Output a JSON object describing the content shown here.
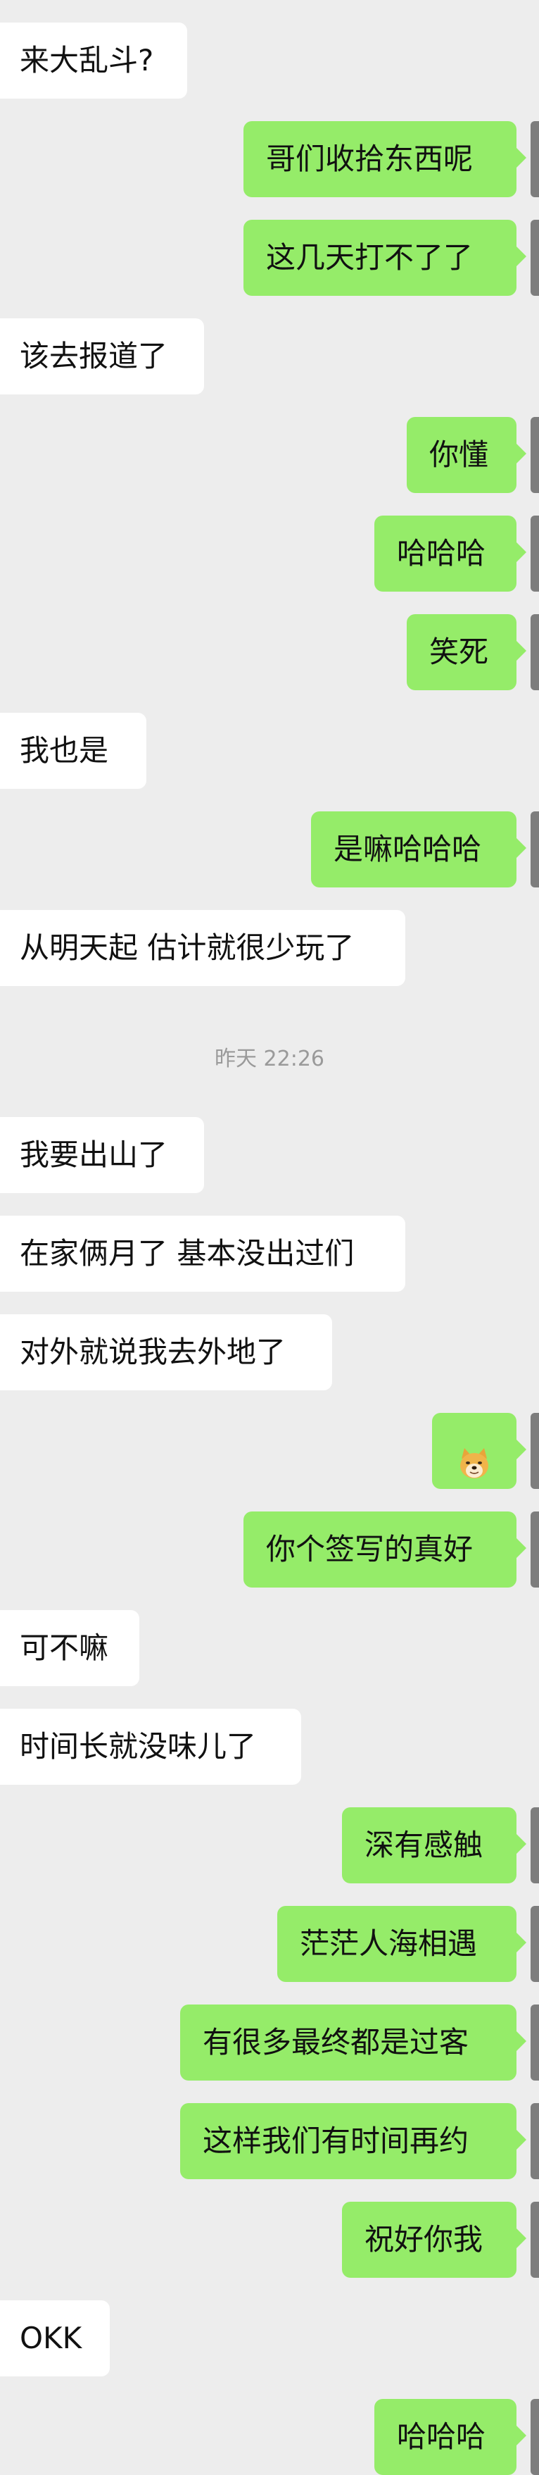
{
  "messages": [
    {
      "side": "left",
      "text": "来大乱斗?"
    },
    {
      "side": "right",
      "text": "哥们收拾东西呢"
    },
    {
      "side": "right",
      "text": "这几天打不了了"
    },
    {
      "side": "left",
      "text": "该去报道了"
    },
    {
      "side": "right",
      "text": "你懂"
    },
    {
      "side": "right",
      "text": "哈哈哈"
    },
    {
      "side": "right",
      "text": "笑死"
    },
    {
      "side": "left",
      "text": "我也是"
    },
    {
      "side": "right",
      "text": "是嘛哈哈哈"
    },
    {
      "side": "left",
      "text": "从明天起 估计就很少玩了"
    },
    {
      "side": "left",
      "text": "我要出山了"
    },
    {
      "side": "left",
      "text": "在家俩月了 基本没出过们"
    },
    {
      "side": "left",
      "text": "对外就说我去外地了"
    },
    {
      "side": "right",
      "text": "",
      "icon": "doge-emoji-icon"
    },
    {
      "side": "right",
      "text": "你个签写的真好"
    },
    {
      "side": "left",
      "text": "可不嘛"
    },
    {
      "side": "left",
      "text": "时间长就没味儿了"
    },
    {
      "side": "right",
      "text": "深有感触"
    },
    {
      "side": "right",
      "text": "茫茫人海相遇"
    },
    {
      "side": "right",
      "text": "有很多最终都是过客"
    },
    {
      "side": "right",
      "text": "这样我们有时间再约"
    },
    {
      "side": "right",
      "text": "祝好你我"
    },
    {
      "side": "left",
      "text": "OKK"
    },
    {
      "side": "right",
      "text": "哈哈哈"
    }
  ],
  "timestamp": "昨天 22:26",
  "colors": {
    "background": "#ededed",
    "incoming_bubble": "#ffffff",
    "outgoing_bubble": "#95ec69",
    "timestamp_text": "#9a9a9a"
  }
}
